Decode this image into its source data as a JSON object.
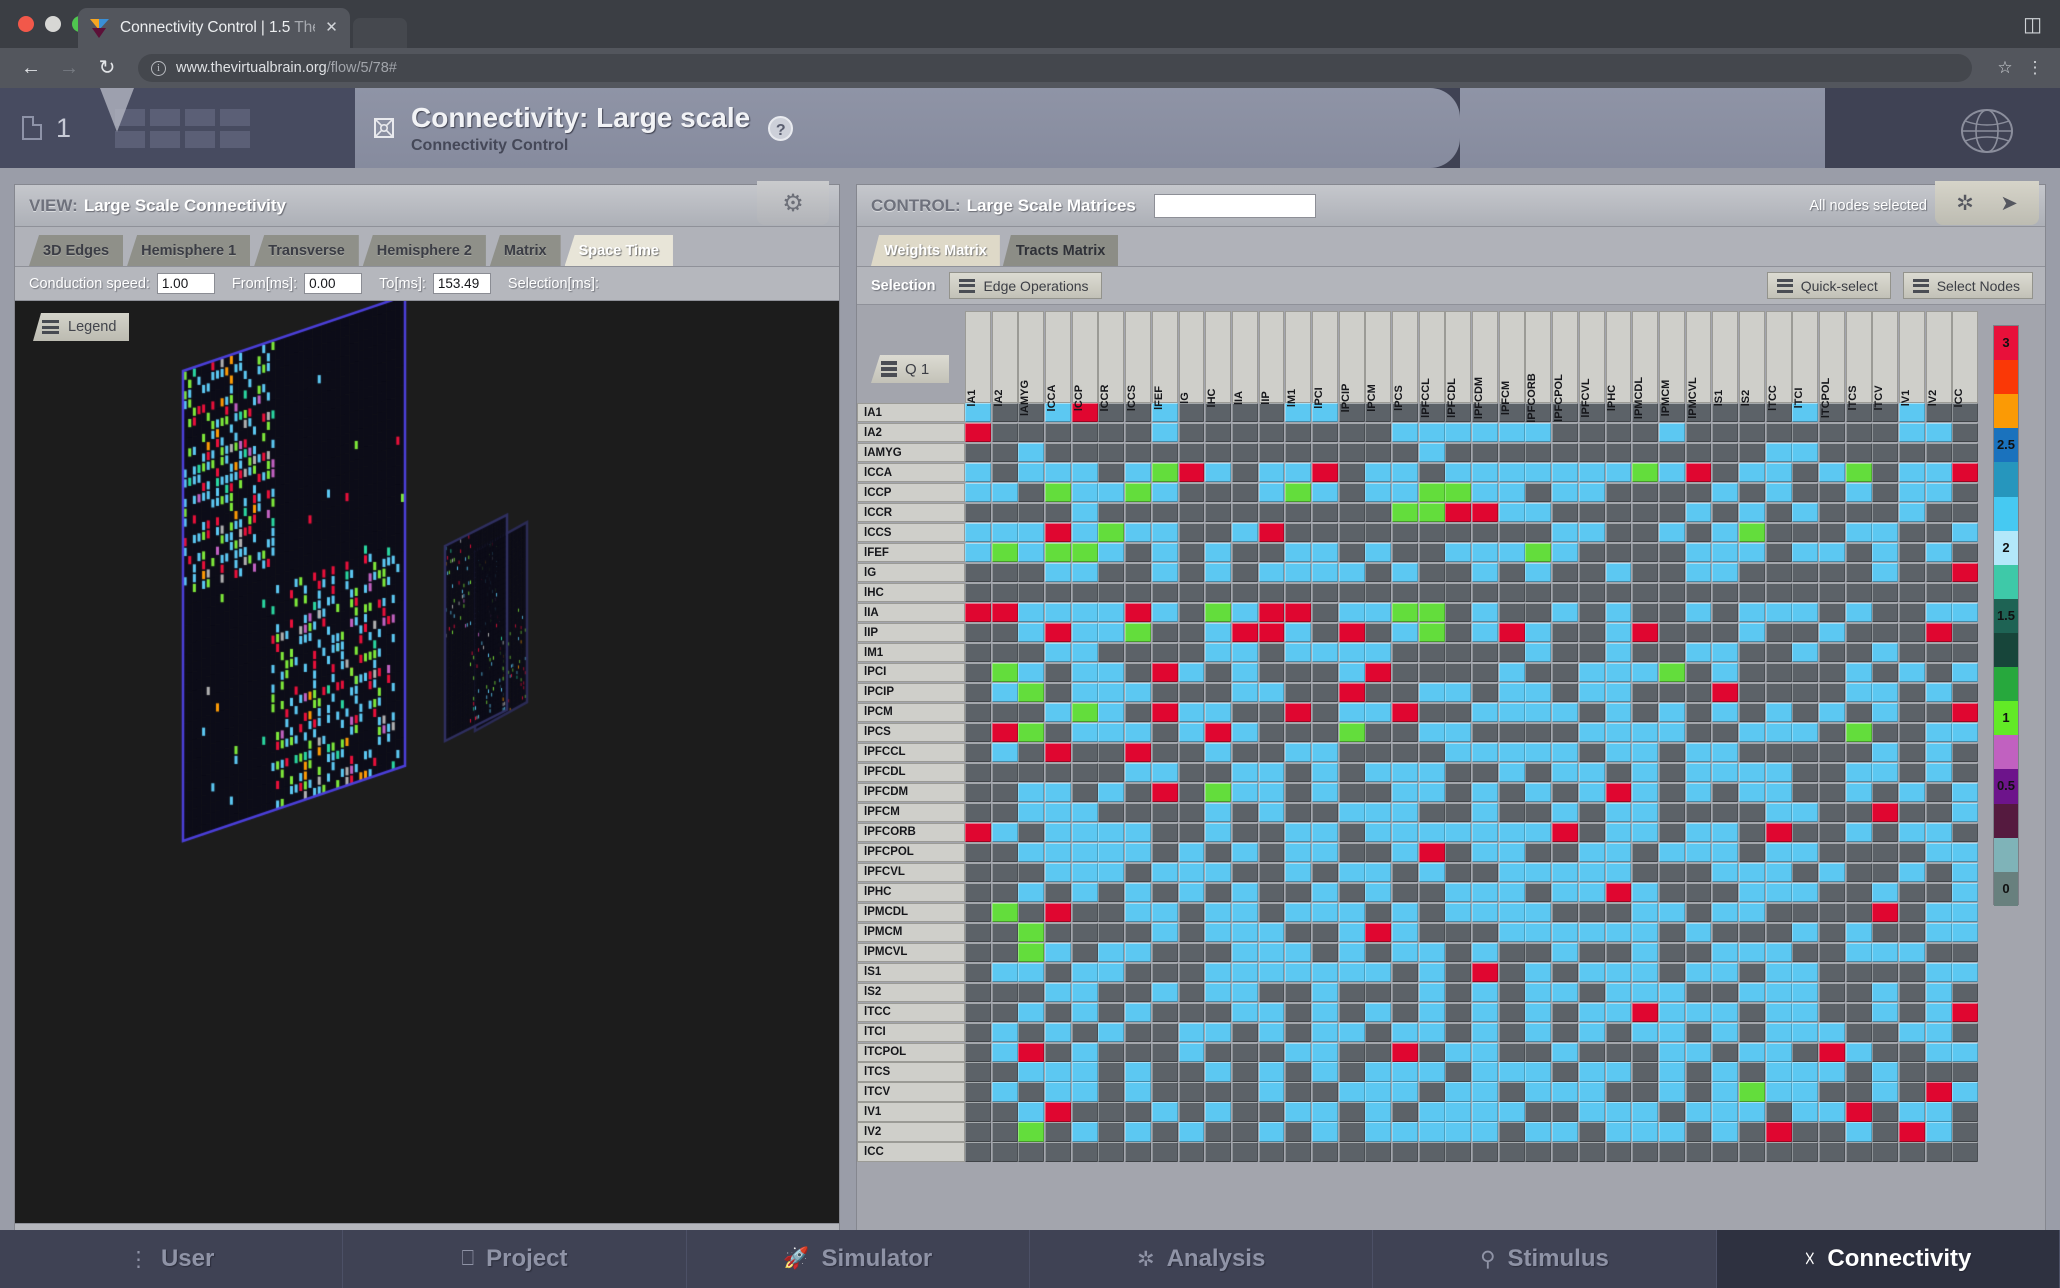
{
  "browser": {
    "tab_title_main": "Connectivity Control | 1.5 ",
    "tab_title_dim": "The",
    "close_icon": "close-icon",
    "back_icon": "back-arrow-icon",
    "forward_icon": "forward-arrow-icon",
    "reload_icon": "reload-icon",
    "url_host": "www.thevirtualbrain.org",
    "url_path": "/flow/5/78#",
    "star_icon": "star-icon",
    "menu_icon": "kebab-menu-icon",
    "extension_icon": "extension-icon"
  },
  "app_header": {
    "doc_count": "1",
    "title": "Connectivity: Large scale",
    "subtitle": "Connectivity Control",
    "help_label": "?",
    "title_icon": "connectivity-node-icon",
    "brain_icon": "brain-globe-icon"
  },
  "view_panel": {
    "label_key": "VIEW:",
    "label_value": "Large Scale Connectivity",
    "gear_icon": "gear-icon",
    "tabs": [
      {
        "label": "3D Edges",
        "active": false
      },
      {
        "label": "Hemisphere 1",
        "active": false
      },
      {
        "label": "Transverse",
        "active": false
      },
      {
        "label": "Hemisphere 2",
        "active": false
      },
      {
        "label": "Matrix",
        "active": false
      },
      {
        "label": "Space Time",
        "active": true
      }
    ],
    "fields": [
      {
        "label": "Conduction speed:",
        "value": "1.00"
      },
      {
        "label": "From[ms]:",
        "value": "0.00"
      },
      {
        "label": "To[ms]:",
        "value": "153.49"
      }
    ],
    "selection_label": "Selection[ms]:",
    "legend_button": "Legend"
  },
  "control_panel": {
    "label_key": "CONTROL:",
    "label_value": "Large Scale Matrices",
    "search_value": "",
    "search_placeholder": "",
    "nodes_status": "All nodes selected",
    "star_tool_icon": "asterisk-icon",
    "share_tool_icon": "share-icon",
    "tabs": [
      {
        "label": "Weights Matrix",
        "active": true
      },
      {
        "label": "Tracts Matrix",
        "active": false
      }
    ],
    "selection_label": "Selection",
    "edge_operations_button": "Edge Operations",
    "quick_select_button": "Quick-select",
    "select_nodes_button": "Select Nodes",
    "quadrant_button": "Q 1"
  },
  "matrix": {
    "labels": [
      "lA1",
      "lA2",
      "lAMYG",
      "lCCA",
      "lCCP",
      "lCCR",
      "lCCS",
      "lFEF",
      "lG",
      "lHC",
      "lIA",
      "lIP",
      "lM1",
      "lPCI",
      "lPCIP",
      "lPCM",
      "lPCS",
      "lPFCCL",
      "lPFCDL",
      "lPFCDM",
      "lPFCM",
      "lPFCORB",
      "lPFCPOL",
      "lPFCVL",
      "lPHC",
      "lPMCDL",
      "lPMCM",
      "lPMCVL",
      "lS1",
      "lS2",
      "lTCC",
      "lTCI",
      "lTCPOL",
      "lTCS",
      "lTCV",
      "lV1",
      "lV2",
      "lCC"
    ],
    "cell_colors": {
      "empty": "#5c6268",
      "low": "#5cc8f2",
      "mid": "#63dd3c",
      "high": "#e00630"
    },
    "cells": [
      "10013001000011000000000000000001000100",
      "30000001000000001111110000100000000110",
      "00100000000000000100000000000011000000",
      "10111012310113011011111112130110120113",
      "11021121000121011221101100001010010110",
      "00001000000000002233110000010101000100",
      "11131211001300000000001100101200011001",
      "12122101010011010011121000011101101010",
      "00011001010111101001010010011000001003",
      "00000000000000000000000000000000000000",
      "33111131021330112201001010010111010011",
      "00131120013310301201310013000100100030",
      "00011000011011110000010010011001001000",
      "02101103101000130000100111201000010101",
      "01201110001100300110110110003000011010",
      "00012103110030113001111010101010101003",
      "03201110131000200110000111100111020011",
      "01030030010011000011111011011000001010",
      "00000011001101011100101101011110011010",
      "00110103021101001101010131010110010101",
      "00111000010100111001001011000011003001",
      "31011110010011011111113011011030010110",
      "00111110101011001301100110111011000011",
      "00011101110010110100111110001110100101",
      "00101010101001010011101131000111001001",
      "02030011011011101011110001101100003011",
      "00200001011100131000111111010001010011",
      "00210110001110101101001001001110011100",
      "01101100011111110103010111011011000011",
      "00011001011001000101011011100111001010",
      "00101010001101010101010113111011001013",
      "01010100110101101101010101101011100110",
      "01301000100011003011001000110110310011",
      "00111010010101011101110110101011101000",
      "01011010000100111011011100101211001031",
      "00130001010011010111100111011101130110",
      "00201010100101011111011011101030010310",
      "00000000000000000000000000000000000000"
    ]
  },
  "colorbar": {
    "ticks": [
      "3",
      "2.5",
      "2",
      "1.5",
      "1",
      "0.5",
      "0"
    ],
    "stops": [
      {
        "color": "#e8103a",
        "label": "3"
      },
      {
        "color": "#fa3806",
        "label": ""
      },
      {
        "color": "#fb9a05",
        "label": ""
      },
      {
        "color": "#1a72bd",
        "label": "2.5"
      },
      {
        "color": "#2696bd",
        "label": ""
      },
      {
        "color": "#46c9f2",
        "label": ""
      },
      {
        "color": "#b3e8fa",
        "label": "2"
      },
      {
        "color": "#3ec9a8",
        "label": ""
      },
      {
        "color": "#1e6354",
        "label": "1.5"
      },
      {
        "color": "#17453a",
        "label": ""
      },
      {
        "color": "#27a83d",
        "label": ""
      },
      {
        "color": "#62ea26",
        "label": "1"
      },
      {
        "color": "#c161c0",
        "label": ""
      },
      {
        "color": "#6d148b",
        "label": "0.5"
      },
      {
        "color": "#551a3f",
        "label": ""
      },
      {
        "color": "#7fb3b8",
        "label": ""
      },
      {
        "color": "#68807e",
        "label": "0"
      }
    ]
  },
  "bottom_nav": [
    {
      "label": "User",
      "icon": "user-icon",
      "glyph": "•",
      "active": false
    },
    {
      "label": "Project",
      "icon": "project-icon",
      "glyph": "⬚",
      "active": false
    },
    {
      "label": "Simulator",
      "icon": "simulator-icon",
      "glyph": "↑",
      "active": false
    },
    {
      "label": "Analysis",
      "icon": "analysis-icon",
      "glyph": "✱",
      "active": false
    },
    {
      "label": "Stimulus",
      "icon": "stimulus-icon",
      "glyph": "○",
      "active": false
    },
    {
      "label": "Connectivity",
      "icon": "connectivity-icon",
      "glyph": "⌧",
      "active": true
    }
  ]
}
